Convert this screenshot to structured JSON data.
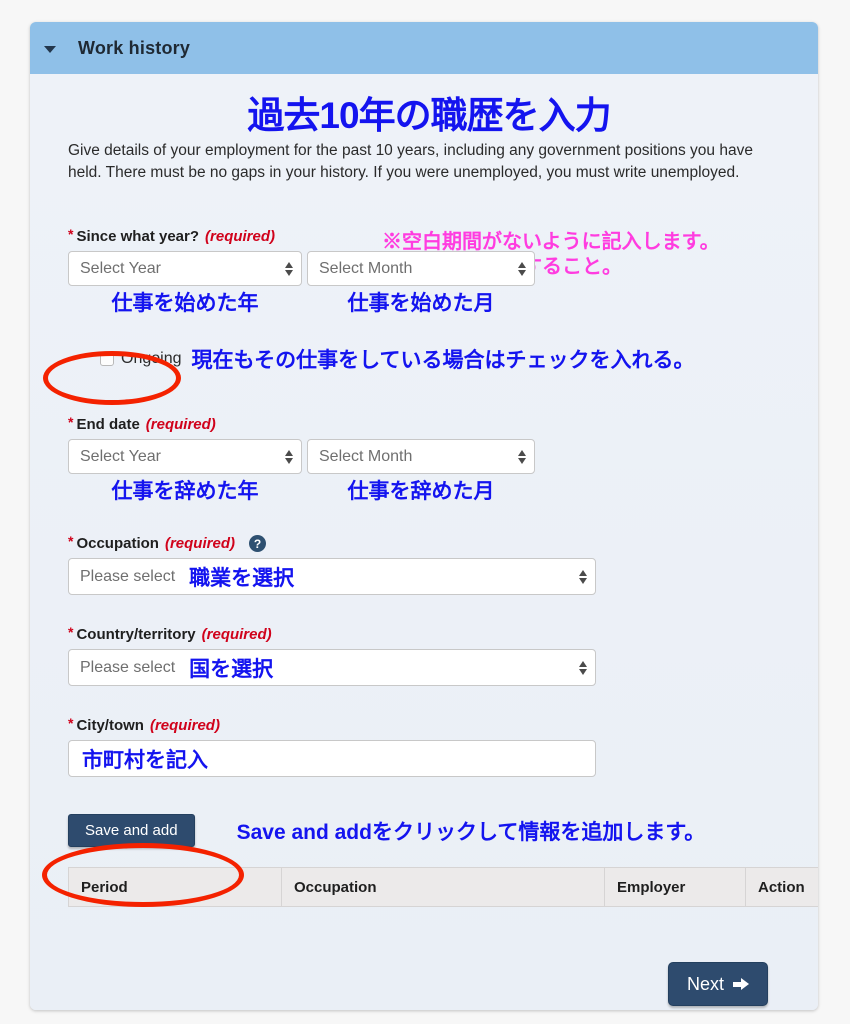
{
  "panel": {
    "header_title": "Work history",
    "collapse_icon": "caret-down-icon"
  },
  "headline_jp": "過去10年の職歴を入力",
  "intro_text": "Give details of your employment for the past 10 years, including any government positions you have held. There must be no gaps in your history. If you were unemployed, you must write unemployed.",
  "annotations": {
    "magenta_line1": "※空白期間がないように記入します。",
    "magenta_line2": "無職期間も記入すること。",
    "ongoing_note": "現在もその仕事をしている場合はチェックを入れる。",
    "save_add_note": "Save and addをクリックして情報を追加します。"
  },
  "fields": {
    "since_year": {
      "label": "Since what year?",
      "required_text": "(required)",
      "star": "*",
      "year_placeholder": "Select Year",
      "month_placeholder": "Select Month",
      "year_note": "仕事を始めた年",
      "month_note": "仕事を始めた月"
    },
    "ongoing": {
      "label": "Ongoing",
      "checked": false
    },
    "end_date": {
      "label": "End date",
      "required_text": "(required)",
      "star": "*",
      "year_placeholder": "Select Year",
      "month_placeholder": "Select Month",
      "year_note": "仕事を辞めた年",
      "month_note": "仕事を辞めた月"
    },
    "occupation": {
      "label": "Occupation",
      "required_text": "(required)",
      "star": "*",
      "help_icon": "question-mark-icon",
      "placeholder": "Please select",
      "note": "職業を選択"
    },
    "country": {
      "label": "Country/territory",
      "required_text": "(required)",
      "star": "*",
      "placeholder": "Please select",
      "note": "国を選択"
    },
    "city": {
      "label": "City/town",
      "required_text": "(required)",
      "star": "*",
      "value": "市町村を記入"
    }
  },
  "buttons": {
    "save_and_add": "Save and add",
    "next": "Next",
    "next_icon": "arrow-right-icon"
  },
  "table": {
    "columns": [
      "Period",
      "Occupation",
      "Employer",
      "Action"
    ],
    "rows": []
  },
  "colors": {
    "panel_header": "#8fc0e8",
    "panel_body": "#eef2f8",
    "annotation_blue": "#1414ef",
    "annotation_magenta": "#ff3ce0",
    "highlight_red": "#f42200",
    "required_red": "#d0021b",
    "button_navy": "#2e4b6e"
  }
}
